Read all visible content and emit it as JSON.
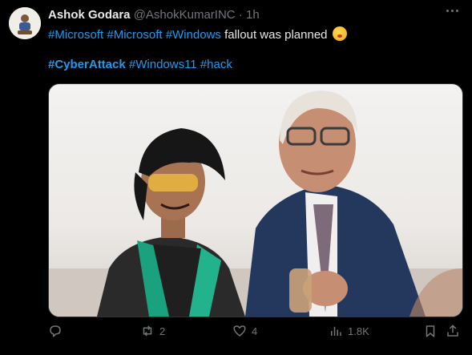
{
  "post": {
    "author_name": "Ashok Godara",
    "author_handle": "@AshokKumarINC",
    "separator": " · ",
    "time": "1h",
    "line1": {
      "tags": [
        "#Microsoft",
        "#Microsoft",
        "#Windows"
      ],
      "text": " fallout was planned "
    },
    "line2": {
      "bold_tag": "#CyberAttack",
      "tags": [
        "#Windows11",
        "#hack"
      ]
    }
  },
  "actions": {
    "reply_count": "",
    "repost_count": "2",
    "like_count": "4",
    "views_count": "1.8K"
  },
  "colors": {
    "background": "#000000",
    "link": "#1d9bf0",
    "muted": "#71767b"
  },
  "icons": [
    "more-icon",
    "reply-icon",
    "repost-icon",
    "like-icon",
    "views-icon",
    "bookmark-icon",
    "share-icon"
  ]
}
